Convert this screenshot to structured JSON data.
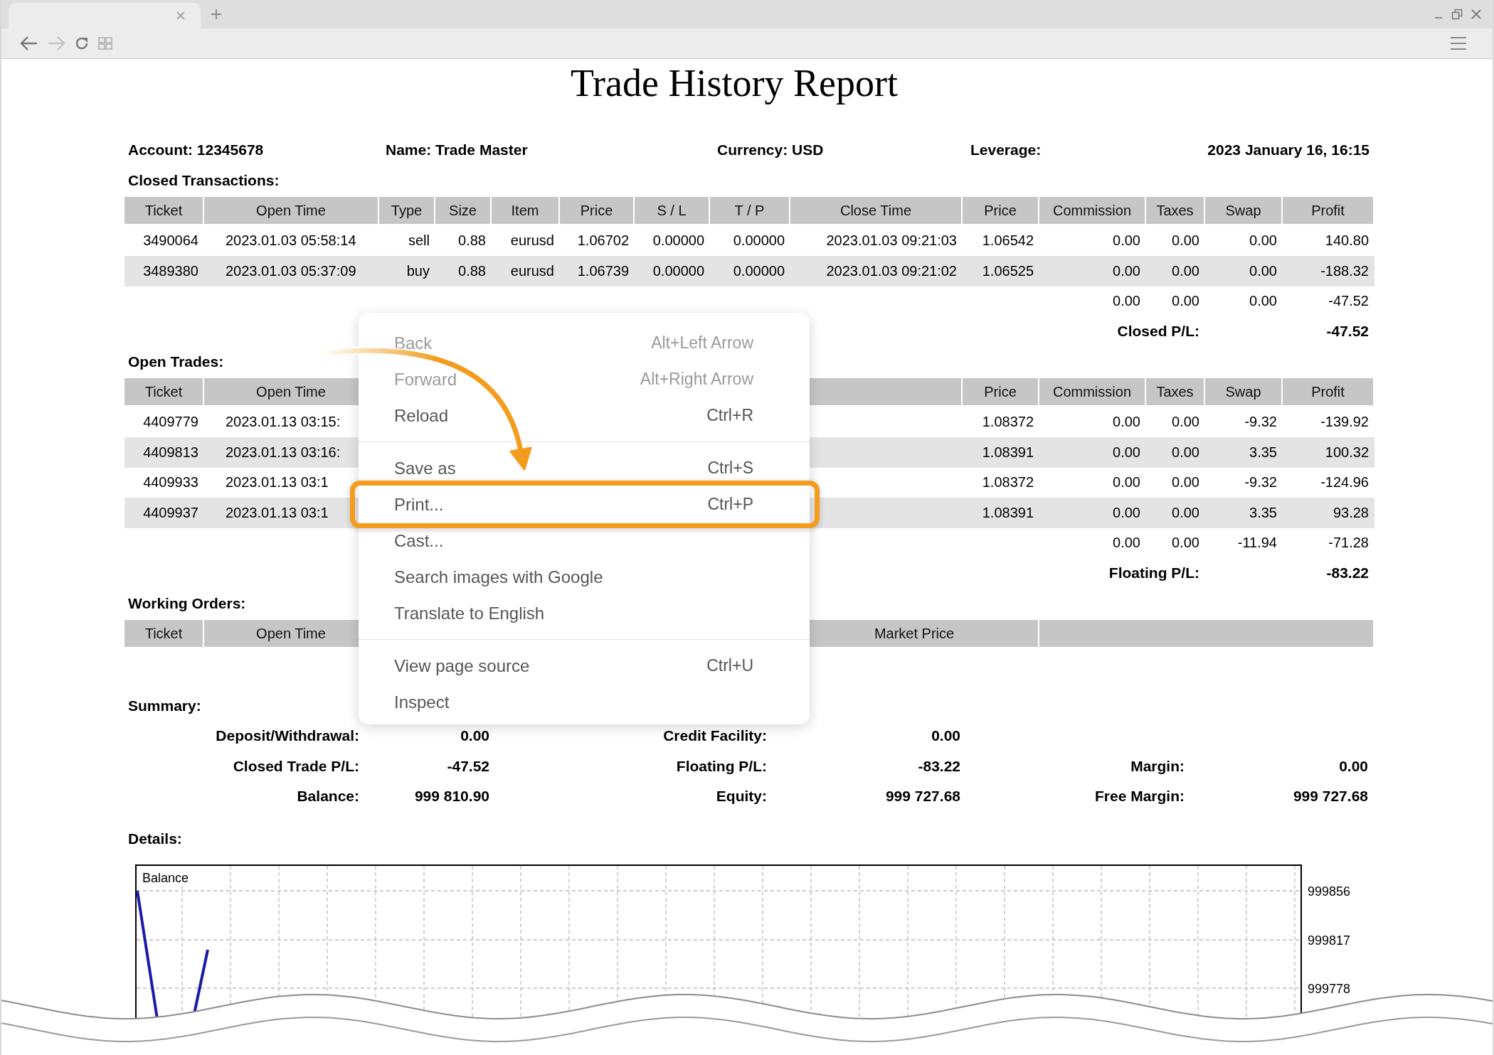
{
  "browser": {
    "back": {
      "disabled": false
    },
    "forward": {
      "disabled": true
    }
  },
  "report": {
    "title": "Trade History Report",
    "info": [
      "Account: 12345678",
      "Name: Trade Master",
      "Currency: USD",
      "Leverage:",
      "2023 January 16, 16:15"
    ],
    "closed_transactions": {
      "label": "Closed Transactions:",
      "columns": [
        "Ticket",
        "Open Time",
        "Type",
        "Size",
        "Item",
        "Price",
        "S / L",
        "T / P",
        "Close Time",
        "Price",
        "Commission",
        "Taxes",
        "Swap",
        "Profit"
      ],
      "rows": [
        [
          "3490064",
          "2023.01.03 05:58:14",
          "sell",
          "0.88",
          "eurusd",
          "1.06702",
          "0.00000",
          "0.00000",
          "2023.01.03 09:21:03",
          "1.06542",
          "0.00",
          "0.00",
          "0.00",
          "140.80"
        ],
        [
          "3489380",
          "2023.01.03 05:37:09",
          "buy",
          "0.88",
          "eurusd",
          "1.06739",
          "0.00000",
          "0.00000",
          "2023.01.03 09:21:02",
          "1.06525",
          "0.00",
          "0.00",
          "0.00",
          "-188.32"
        ]
      ],
      "totals": [
        "0.00",
        "0.00",
        "0.00",
        "-47.52"
      ],
      "result_label": "Closed P/L:",
      "result": "-47.52"
    },
    "open_trades": {
      "label": "Open Trades:",
      "columns": [
        "Ticket",
        "Open Time",
        "Price",
        "Commission",
        "Taxes",
        "Swap",
        "Profit"
      ],
      "rows": [
        [
          "4409779",
          "2023.01.13 03:15:",
          "1.08372",
          "0.00",
          "0.00",
          "-9.32",
          "-139.92"
        ],
        [
          "4409813",
          "2023.01.13 03:16:",
          "1.08391",
          "0.00",
          "0.00",
          "3.35",
          "100.32"
        ],
        [
          "4409933",
          "2023.01.13 03:1",
          "1.08372",
          "0.00",
          "0.00",
          "-9.32",
          "-124.96"
        ],
        [
          "4409937",
          "2023.01.13 03:1",
          "1.08391",
          "0.00",
          "0.00",
          "3.35",
          "93.28"
        ]
      ],
      "totals": [
        "0.00",
        "0.00",
        "-11.94",
        "-71.28"
      ],
      "result_label": "Floating P/L:",
      "result": "-83.22"
    },
    "working_orders": {
      "label": "Working Orders:",
      "columns": [
        "Ticket",
        "Open Time",
        "Market Price"
      ]
    },
    "summary": {
      "label": "Summary:",
      "rows": [
        [
          {
            "label": "Deposit/Withdrawal:",
            "value": "0.00"
          },
          {
            "label": "Credit Facility:",
            "value": "0.00"
          }
        ],
        [
          {
            "label": "Closed Trade P/L:",
            "value": "-47.52"
          },
          {
            "label": "Floating P/L:",
            "value": "-83.22"
          },
          {
            "label": "Margin:",
            "value": "0.00"
          }
        ],
        [
          {
            "label": "Balance:",
            "value": "999 810.90"
          },
          {
            "label": "Equity:",
            "value": "999 727.68"
          },
          {
            "label": "Free Margin:",
            "value": "999 727.68"
          }
        ]
      ]
    },
    "details": {
      "label": "Details:",
      "chart": {
        "title": "Balance",
        "y_labels": [
          "999856",
          "999817",
          "999778"
        ]
      }
    }
  },
  "context_menu": {
    "groups": [
      [
        {
          "label": "Back",
          "shortcut": "Alt+Left Arrow",
          "disabled": true,
          "highlighted": false
        },
        {
          "label": "Forward",
          "shortcut": "Alt+Right Arrow",
          "disabled": true,
          "highlighted": false
        },
        {
          "label": "Reload",
          "shortcut": "Ctrl+R",
          "disabled": false,
          "highlighted": false
        }
      ],
      [
        {
          "label": "Save as",
          "shortcut": "Ctrl+S",
          "disabled": false,
          "highlighted": false
        },
        {
          "label": "Print...",
          "shortcut": "Ctrl+P",
          "disabled": false,
          "highlighted": true
        },
        {
          "label": "Cast...",
          "disabled": false,
          "highlighted": false
        },
        {
          "label": "Search images with Google",
          "disabled": false,
          "highlighted": false
        },
        {
          "label": "Translate to English",
          "disabled": false,
          "highlighted": false
        }
      ],
      [
        {
          "label": "View page source",
          "shortcut": "Ctrl+U",
          "disabled": false,
          "highlighted": false
        },
        {
          "label": "Inspect",
          "disabled": false,
          "highlighted": false
        }
      ]
    ]
  }
}
